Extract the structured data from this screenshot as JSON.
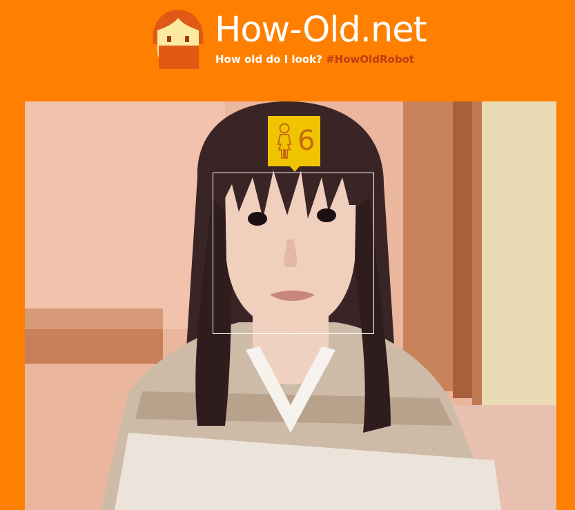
{
  "header": {
    "title": "How-Old.net",
    "question": "How old do I look?",
    "hashtag": "#HowOldRobot"
  },
  "result": {
    "gender_icon": "female-icon",
    "age": "6"
  },
  "colors": {
    "background": "#ff8000",
    "badge": "#f0c400",
    "hashtag": "#c03c14",
    "age_text": "#c46a12"
  }
}
